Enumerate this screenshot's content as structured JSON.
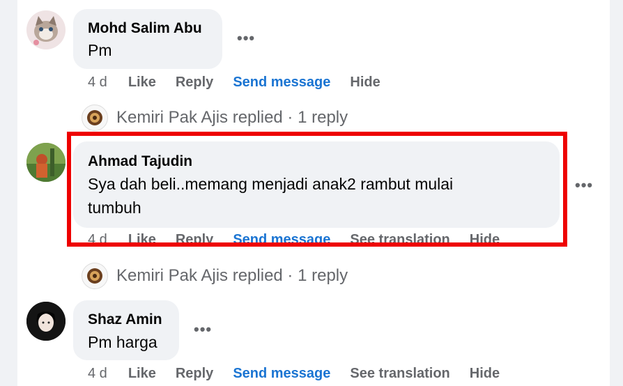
{
  "comments": [
    {
      "author": "Mohd Salim Abu",
      "text": "Pm",
      "time": "4 d",
      "actions": [
        "Like",
        "Reply",
        "Send message",
        "Hide"
      ],
      "more": "•••"
    },
    {
      "author": "Ahmad Tajudin",
      "text_line1": "Sya dah beli..memang menjadi anak2 rambut mulai",
      "text_line2": "tumbuh",
      "time": "4 d",
      "actions": [
        "Like",
        "Reply",
        "Send message",
        "See translation",
        "Hide"
      ],
      "more": "•••"
    },
    {
      "author": "Shaz Amin",
      "text": "Pm harga",
      "time": "4 d",
      "actions": [
        "Like",
        "Reply",
        "Send message",
        "See translation",
        "Hide"
      ],
      "more": "•••"
    }
  ],
  "replies": [
    {
      "text": "Kemiri Pak Ajis replied · 1 reply"
    },
    {
      "text": "Kemiri Pak Ajis replied · 1 reply"
    }
  ],
  "colors": {
    "link_blue": "#1a74d2",
    "secondary_text": "#65676b",
    "bubble_bg": "#f0f2f5",
    "highlight_red": "#ee0000"
  }
}
